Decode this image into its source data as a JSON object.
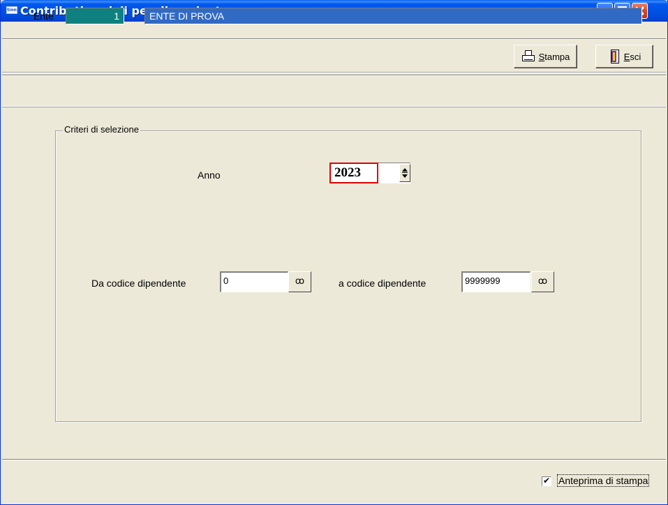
{
  "window": {
    "icon_text": "tinn",
    "title": "Contributi sociali per dipendente"
  },
  "toolbar": {
    "stampa_label_accel": "S",
    "stampa_label_rest": "tampa",
    "esci_label_accel": "E",
    "esci_label_rest": "sci"
  },
  "ente": {
    "label": "Ente",
    "code": "1",
    "name": "ENTE DI PROVA"
  },
  "criteria": {
    "legend": "Criteri di selezione",
    "anno_label": "Anno",
    "anno_value": "2023",
    "da_label": "Da codice dipendente",
    "da_value": "0",
    "a_label": "a codice dipendente",
    "a_value": "9999999",
    "lookup_glyph": "ꝏ"
  },
  "footer": {
    "preview_label": "Anteprima di stampa",
    "preview_checked": true,
    "check_glyph": "✔"
  }
}
